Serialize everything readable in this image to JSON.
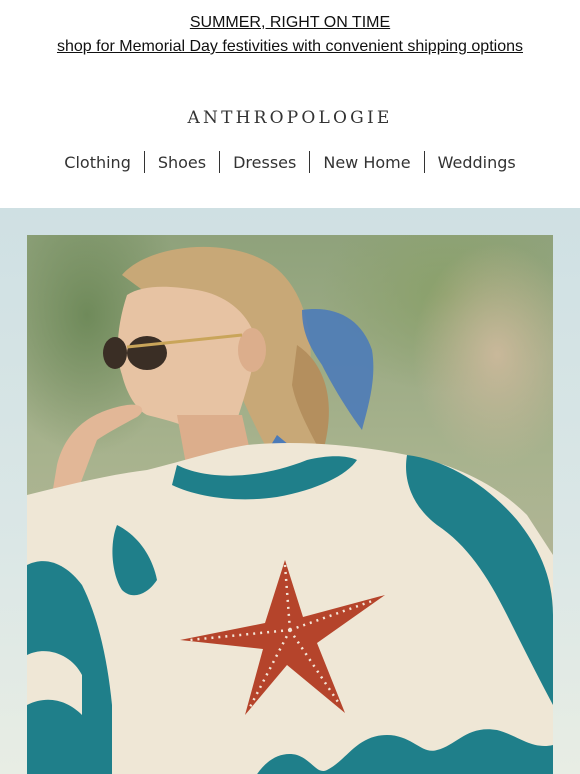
{
  "promo": {
    "title": "SUMMER, RIGHT ON TIME",
    "subtitle": "shop for Memorial Day festivities with convenient shipping options"
  },
  "brand": {
    "logo_text": "ANTHROPOLOGIE"
  },
  "nav": {
    "items": [
      {
        "label": "Clothing"
      },
      {
        "label": "Shoes"
      },
      {
        "label": "Dresses"
      },
      {
        "label": "New Home"
      },
      {
        "label": "Weddings"
      }
    ]
  },
  "hero": {
    "image_icon": "hero-photo-woman-starfish-sweater",
    "colors": {
      "sweater_teal": "#1f7f8a",
      "sweater_cream": "#efe7d6",
      "starfish": "#b5442b"
    }
  }
}
